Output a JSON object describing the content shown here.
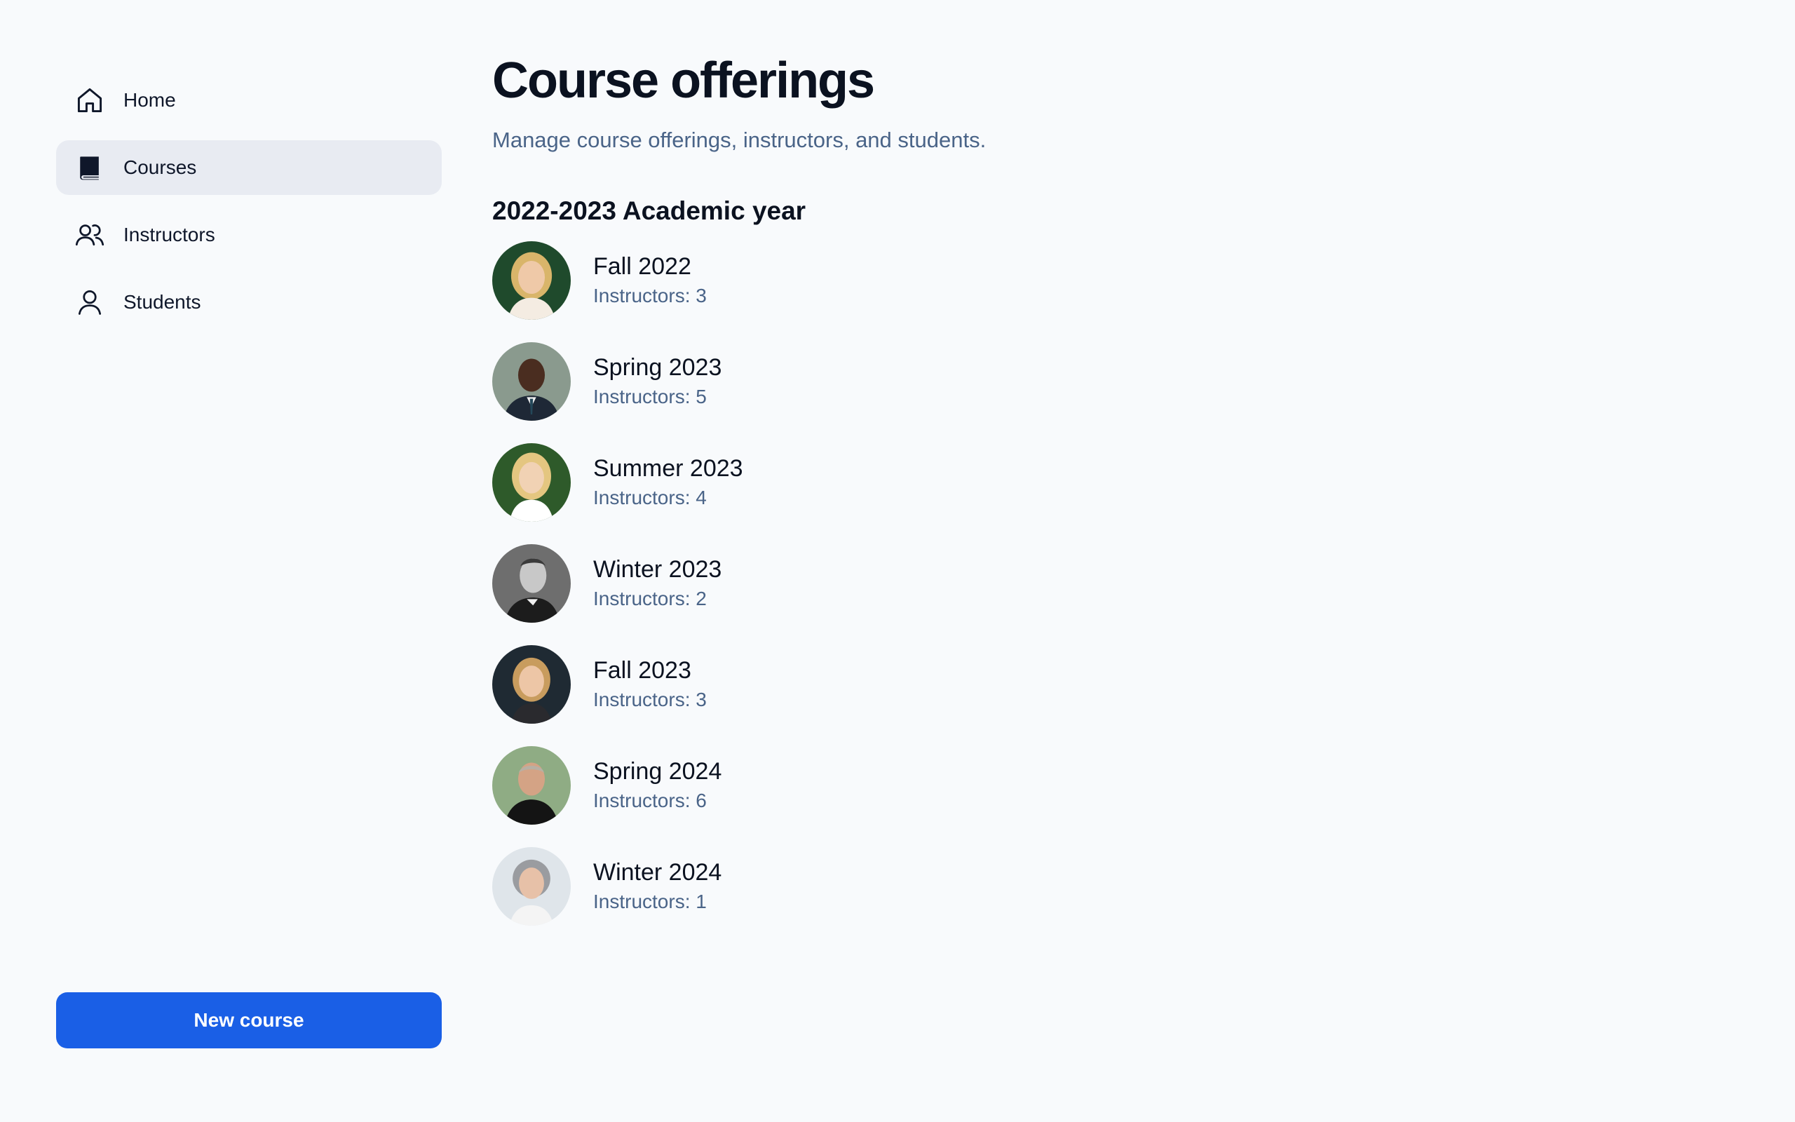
{
  "sidebar": {
    "items": [
      {
        "label": "Home",
        "icon": "home-icon",
        "active": false
      },
      {
        "label": "Courses",
        "icon": "book-icon",
        "active": true
      },
      {
        "label": "Instructors",
        "icon": "users-icon",
        "active": false
      },
      {
        "label": "Students",
        "icon": "user-icon",
        "active": false
      }
    ],
    "new_course_label": "New course"
  },
  "main": {
    "title": "Course offerings",
    "subtitle": "Manage course offerings, instructors, and students.",
    "section_heading": "2022-2023 Academic year",
    "offerings": [
      {
        "name": "Fall 2022",
        "instructors": "Instructors: 3"
      },
      {
        "name": "Spring 2023",
        "instructors": "Instructors: 5"
      },
      {
        "name": "Summer 2023",
        "instructors": "Instructors: 4"
      },
      {
        "name": "Winter 2023",
        "instructors": "Instructors: 2"
      },
      {
        "name": "Fall 2023",
        "instructors": "Instructors: 3"
      },
      {
        "name": "Spring 2024",
        "instructors": "Instructors: 6"
      },
      {
        "name": "Winter 2024",
        "instructors": "Instructors: 1"
      }
    ]
  },
  "colors": {
    "background": "#f8fafc",
    "active_nav": "#e8ebf2",
    "primary_button": "#1a5fe6",
    "muted_text": "#4a6488"
  }
}
